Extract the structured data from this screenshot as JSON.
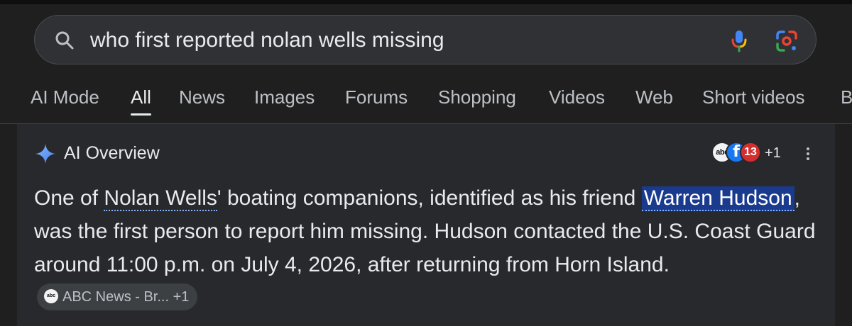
{
  "search": {
    "query": "who first reported nolan wells missing"
  },
  "tabs": [
    {
      "label": "AI Mode"
    },
    {
      "label": "All"
    },
    {
      "label": "News"
    },
    {
      "label": "Images"
    },
    {
      "label": "Forums"
    },
    {
      "label": "Shopping"
    },
    {
      "label": "Videos"
    },
    {
      "label": "Web"
    },
    {
      "label": "Short videos"
    },
    {
      "label": "B"
    }
  ],
  "active_tab": "All",
  "ai_overview": {
    "title": "AI Overview",
    "sources": {
      "icons": [
        {
          "text": "abc",
          "icon": "abc-news-icon"
        },
        {
          "text": "f",
          "icon": "facebook-icon"
        },
        {
          "text": "13",
          "icon": "channel-13-icon"
        }
      ],
      "more": "+1"
    },
    "answer": {
      "t1": "One of ",
      "link1": "Nolan Wells",
      "t2": "' boating companions, identified as his friend ",
      "link2": "Warren Hudson",
      "t3": ", was the first person to report him missing. Hudson contacted the U.S. Coast Guard around 11:00 p.m. on July 4, 2026, after returning from Horn Island. "
    },
    "citation": {
      "label": "ABC News - Br... +1",
      "icon_text": "abc"
    }
  },
  "colors": {
    "background": "#1f1f1f",
    "panel": "#28292c",
    "highlight": "#1a3a8e",
    "link_underline": "#8ab4f8"
  }
}
